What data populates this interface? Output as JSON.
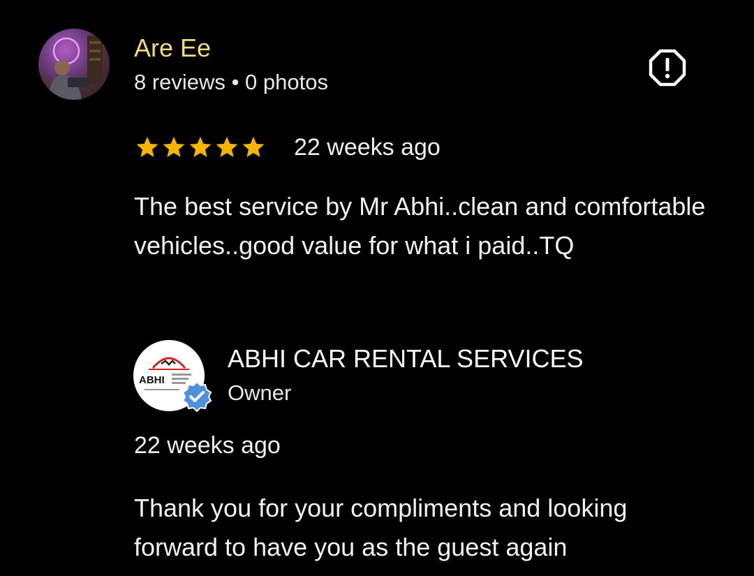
{
  "reviewer": {
    "name": "Are Ee",
    "reviews_count": "8 reviews",
    "separator": "•",
    "photos_count": "0 photos",
    "name_color": "#f0dc78"
  },
  "review": {
    "rating": 5,
    "rating_max": 5,
    "star_color": "#f5b400",
    "time": "22 weeks ago",
    "text": "The best service by Mr Abhi..clean and comfortable vehicles..good value for what i paid..TQ"
  },
  "icons": {
    "report": "report-flag-icon",
    "verified": "verified-check-icon",
    "star": "star-icon"
  },
  "owner_response": {
    "business_name": "ABHI CAR RENTAL SERVICES",
    "role": "Owner",
    "time": "22 weeks ago",
    "text": "Thank you for your compliments and looking forward to have you as the guest again",
    "logo_text": "ABHI",
    "logo_subtext": "CAR RENTAL SERVICES",
    "verified_color": "#4f8fe0"
  }
}
